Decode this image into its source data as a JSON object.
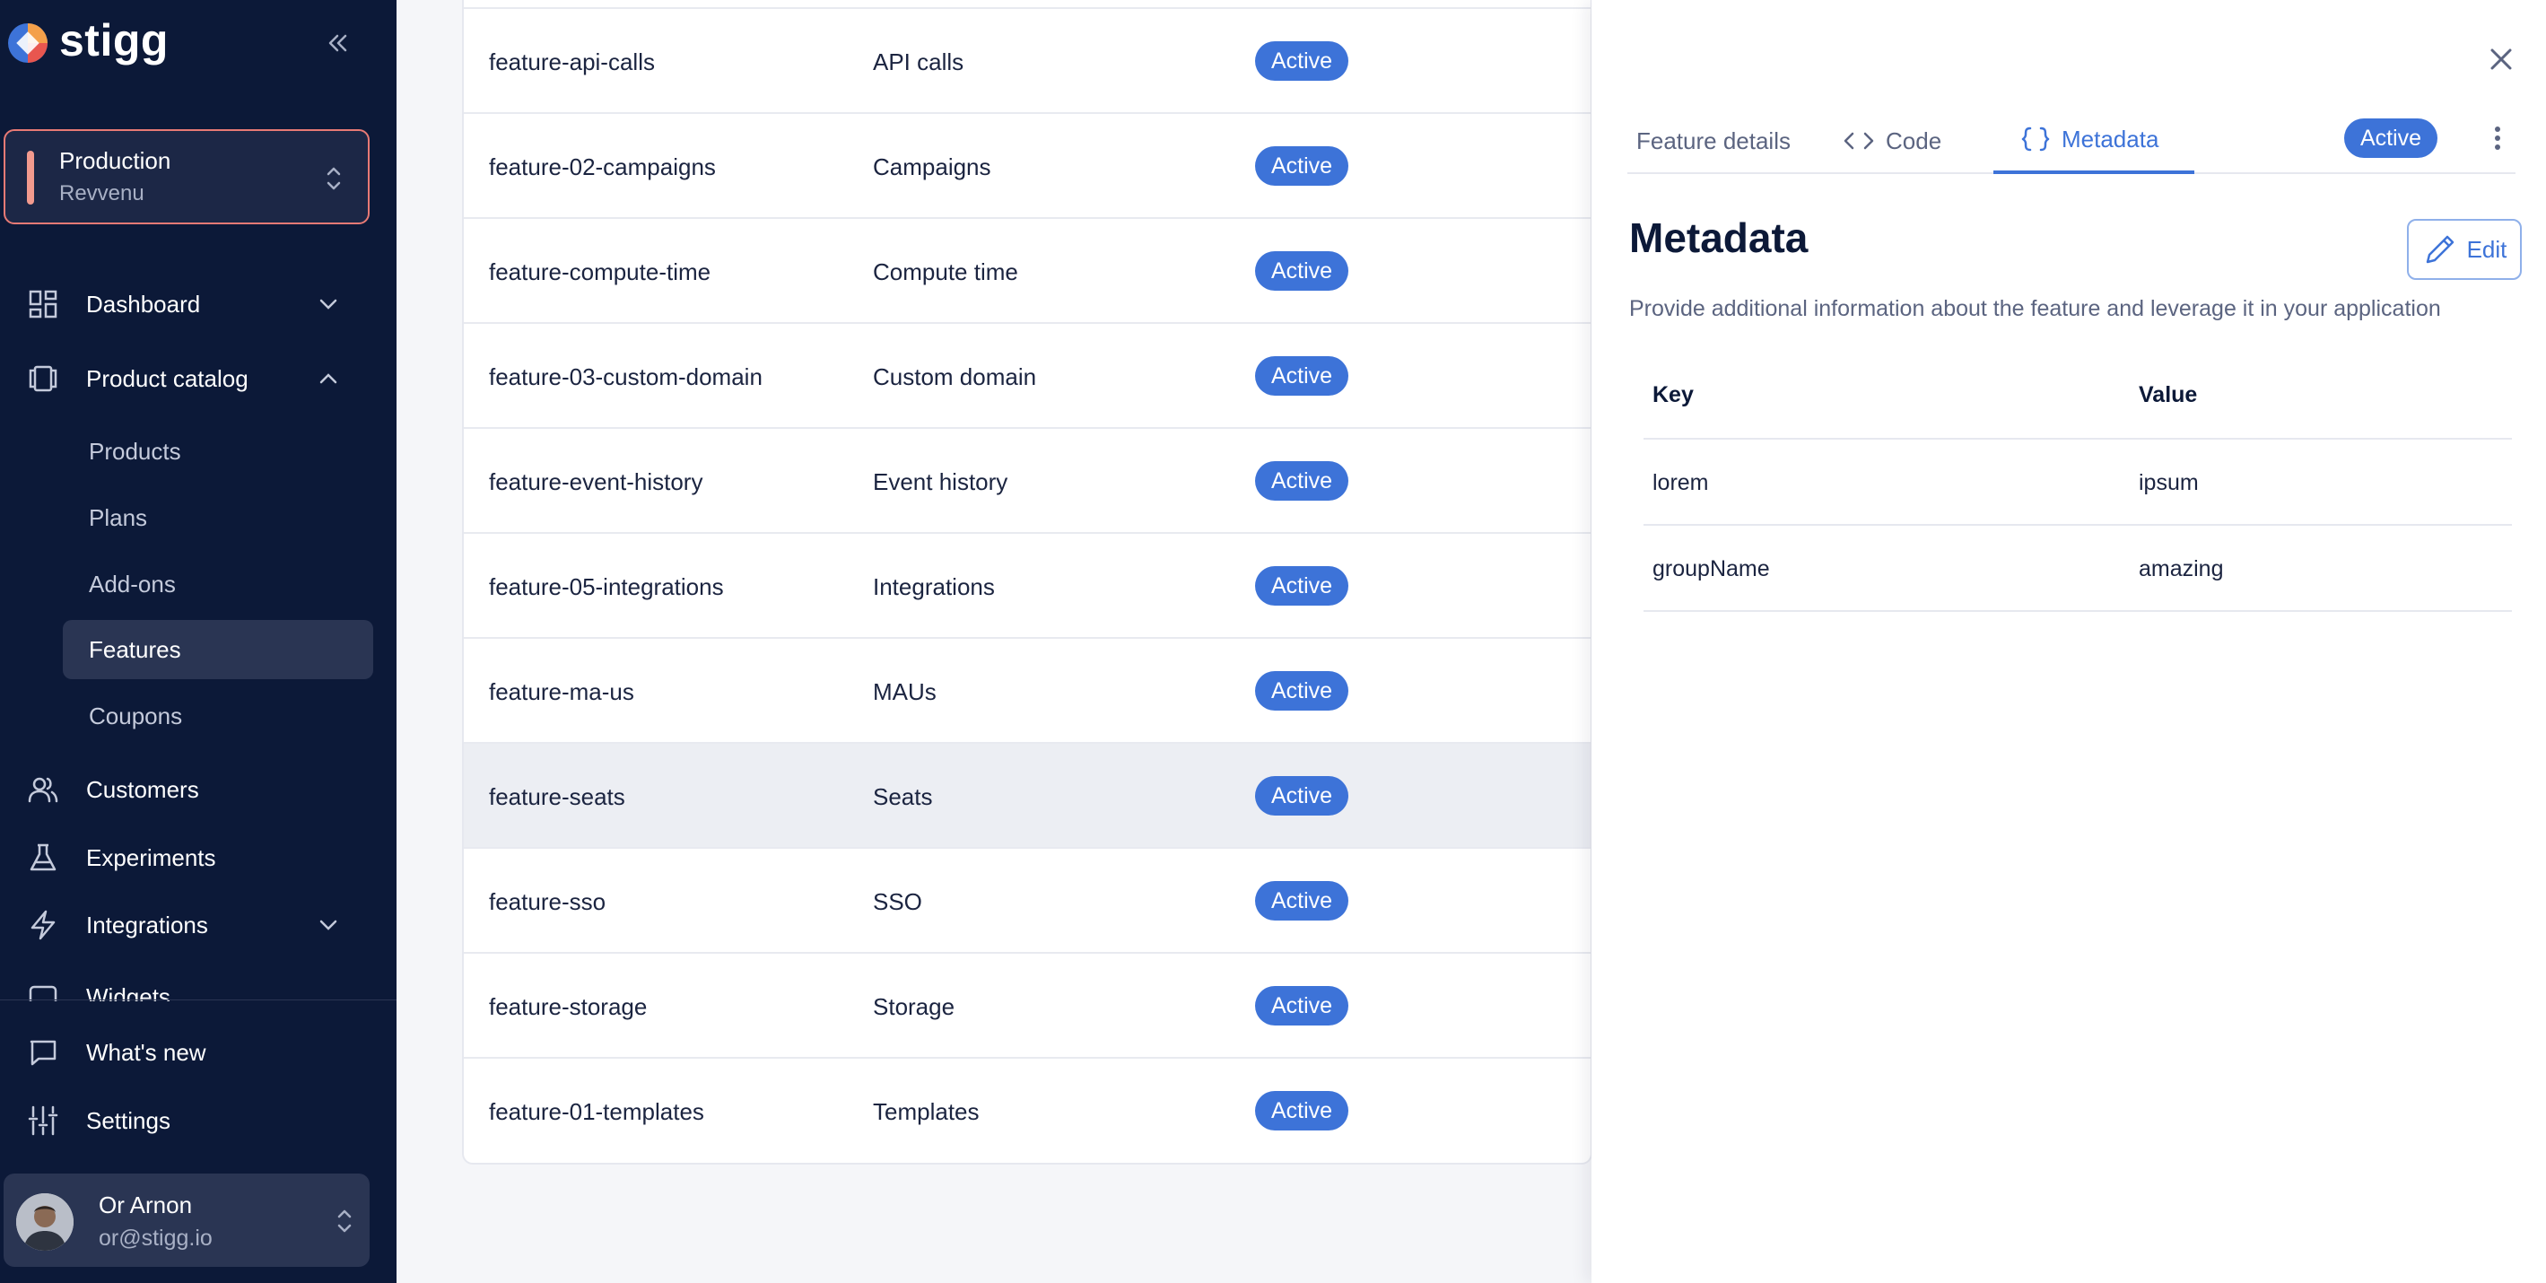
{
  "brand": {
    "name": "stigg"
  },
  "environment": {
    "name": "Production",
    "org": "Revvenu"
  },
  "nav": {
    "dashboard": "Dashboard",
    "product_catalog": "Product catalog",
    "sub": [
      "Products",
      "Plans",
      "Add-ons",
      "Features",
      "Coupons"
    ],
    "customers": "Customers",
    "experiments": "Experiments",
    "integrations": "Integrations",
    "widgets": "Widgets",
    "whats_new": "What's new",
    "settings": "Settings"
  },
  "user": {
    "name": "Or Arnon",
    "email": "or@stigg.io"
  },
  "features": [
    {
      "id": "feature-api-calls",
      "name": "API calls",
      "status": "Active"
    },
    {
      "id": "feature-02-campaigns",
      "name": "Campaigns",
      "status": "Active"
    },
    {
      "id": "feature-compute-time",
      "name": "Compute time",
      "status": "Active"
    },
    {
      "id": "feature-03-custom-domain",
      "name": "Custom domain",
      "status": "Active"
    },
    {
      "id": "feature-event-history",
      "name": "Event history",
      "status": "Active"
    },
    {
      "id": "feature-05-integrations",
      "name": "Integrations",
      "status": "Active"
    },
    {
      "id": "feature-ma-us",
      "name": "MAUs",
      "status": "Active"
    },
    {
      "id": "feature-seats",
      "name": "Seats",
      "status": "Active"
    },
    {
      "id": "feature-sso",
      "name": "SSO",
      "status": "Active"
    },
    {
      "id": "feature-storage",
      "name": "Storage",
      "status": "Active"
    },
    {
      "id": "feature-01-templates",
      "name": "Templates",
      "status": "Active"
    }
  ],
  "drawer": {
    "tabs": {
      "details": "Feature details",
      "code": "Code",
      "metadata": "Metadata"
    },
    "status": "Active",
    "title": "Metadata",
    "edit_label": "Edit",
    "description": "Provide additional information about the feature and leverage it in your application",
    "table": {
      "key_header": "Key",
      "value_header": "Value",
      "rows": [
        {
          "key": "lorem",
          "value": "ipsum"
        },
        {
          "key": "groupName",
          "value": "amazing"
        }
      ]
    }
  },
  "colors": {
    "sidebar": "#0c1938",
    "accent": "#3d73d8",
    "env_border": "#e87a75"
  }
}
